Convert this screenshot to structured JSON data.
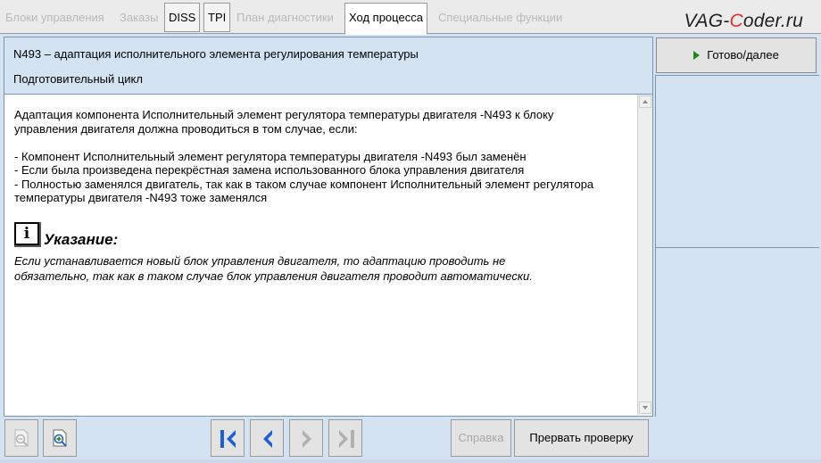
{
  "tabs": [
    {
      "label": "Блоки управления",
      "state": "disabled"
    },
    {
      "label": "Заказы",
      "state": "disabled"
    },
    {
      "label": "DISS",
      "state": "enabled"
    },
    {
      "label": "TPI",
      "state": "enabled"
    },
    {
      "label": "План диагностики",
      "state": "disabled"
    },
    {
      "label": "Ход процесса",
      "state": "active"
    },
    {
      "label": "Специальные функции",
      "state": "disabled"
    }
  ],
  "logo": {
    "prefix": "VAG-",
    "accent": "C",
    "suffix": "oder.ru"
  },
  "header": {
    "title": "N493 – адаптация исполнительного элемента регулирования температуры",
    "subtitle": "Подготовительный цикл"
  },
  "content": {
    "intro_line1": "Адаптация компонента Исполнительный элемент регулятора температуры двигателя -N493  к блоку",
    "intro_line2": "управления двигателя должна проводиться в том случае, если:",
    "bullet1": "- Компонент Исполнительный элемент регулятора температуры двигателя -N493  был заменён",
    "bullet2": "- Если была произведена перекрёстная замена использованного блока управления двигателя",
    "bullet3_line1": "- Полностью заменялся двигатель, так как в таком случае компонент Исполнительный элемент регулятора",
    "bullet3_line2": "температуры двигателя -N493  тоже заменялся"
  },
  "note": {
    "icon_letter": "i",
    "title": "Указание:",
    "line1": "Если устанавливается новый блок управления двигателя, то адаптацию проводить не",
    "line2": "обязательно, так как в таком случае блок управления двигателя проводит автоматически."
  },
  "right_panel": {
    "done_label": "Готово/далее"
  },
  "toolbar": {
    "help_label": "Справка",
    "abort_label": "Прервать проверку"
  },
  "colors": {
    "panel_bg": "#d4e3f1",
    "nav_blue": "#1f5fd0",
    "nav_disabled": "#b0b0b0",
    "play_green": "#1a8a1a",
    "logo_accent": "#e03030"
  }
}
